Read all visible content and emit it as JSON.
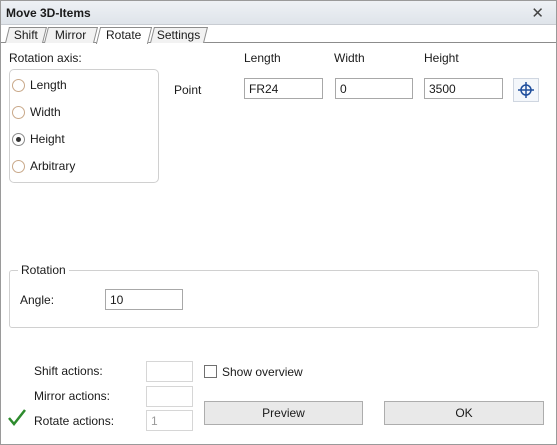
{
  "window": {
    "title": "Move 3D-Items"
  },
  "tabs": [
    {
      "label": "Shift",
      "active": false
    },
    {
      "label": "Mirror",
      "active": false
    },
    {
      "label": "Rotate",
      "active": true
    },
    {
      "label": "Settings",
      "active": false
    }
  ],
  "rotation_axis": {
    "label": "Rotation axis:",
    "options": [
      {
        "label": "Length",
        "checked": false
      },
      {
        "label": "Width",
        "checked": false
      },
      {
        "label": "Height",
        "checked": true
      },
      {
        "label": "Arbitrary",
        "checked": false
      }
    ]
  },
  "point": {
    "label": "Point",
    "headers": {
      "length": "Length",
      "width": "Width",
      "height": "Height"
    },
    "values": {
      "length": "FR24",
      "width": "0",
      "height": "3500"
    }
  },
  "rotation": {
    "group_title": "Rotation",
    "angle_label": "Angle:",
    "angle_value": "10"
  },
  "actions": {
    "shift_label": "Shift actions:",
    "shift_value": "",
    "mirror_label": "Mirror actions:",
    "mirror_value": "",
    "rotate_label": "Rotate actions:",
    "rotate_value": "1"
  },
  "show_overview": {
    "label": "Show overview",
    "checked": false
  },
  "buttons": {
    "preview": "Preview",
    "ok": "OK"
  },
  "icons": {
    "close": "close-icon",
    "pick": "crosshair-icon",
    "check": "check-icon"
  },
  "colors": {
    "check_green": "#2e8b2e"
  }
}
